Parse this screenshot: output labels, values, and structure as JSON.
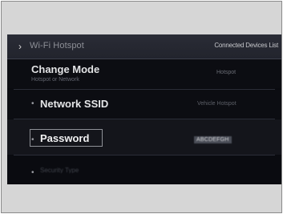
{
  "header": {
    "back_icon": "chevron-right-icon",
    "title": "Wi-Fi Hotspot",
    "connected_devices_label": "Connected Devices List"
  },
  "rows": {
    "change_mode": {
      "title": "Change Mode",
      "subtitle": "Hotspot or Network",
      "value": "Hotspot"
    },
    "network_ssid": {
      "label": "Network SSID",
      "value": "Vehicle Hotspot"
    },
    "password": {
      "label": "Password",
      "value": "ABCDEFGH"
    },
    "extra": {
      "label": "Security Type"
    }
  },
  "colors": {
    "screen_background": "#0a0b10",
    "header_background": "#2a2c36",
    "selection_outline": "#8e9096"
  }
}
